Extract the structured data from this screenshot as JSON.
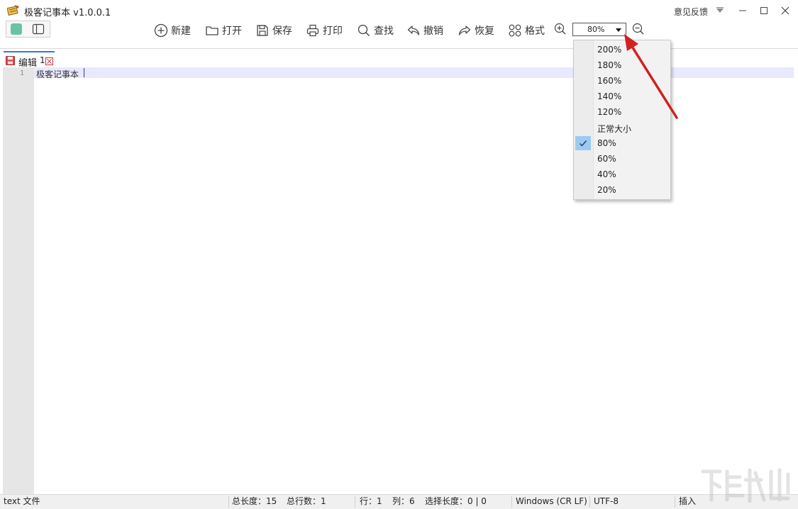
{
  "window": {
    "title": "极客记事本 v1.0.0.1",
    "feedback_label": "意见反馈"
  },
  "toolbar": {
    "new_label": "新建",
    "open_label": "打开",
    "save_label": "保存",
    "print_label": "打印",
    "find_label": "查找",
    "undo_label": "撤销",
    "redo_label": "恢复",
    "format_label": "格式",
    "zoom_value": "80%"
  },
  "tabs": [
    {
      "label": "编辑",
      "number": "1"
    }
  ],
  "editor": {
    "line_number": "1",
    "line_text": "极客记事本"
  },
  "zoom_menu": {
    "items": [
      "200%",
      "180%",
      "160%",
      "140%",
      "120%",
      "正常大小",
      "80%",
      "60%",
      "40%",
      "20%"
    ],
    "selected": "80%"
  },
  "status": {
    "file_type": "text 文件",
    "total_length": "总长度：15",
    "total_lines": "总行数：1",
    "row": "行：1",
    "col": "列：6",
    "selection": "选择长度：0 | 0",
    "line_ending": "Windows (CR LF)",
    "encoding": "UTF-8",
    "mode": "插入"
  },
  "colors": {
    "accent": "#2e7bd6",
    "arrow": "#d32020",
    "current_line": "#e8e8ff",
    "selected_menu": "#9ccbf2",
    "theme_green": "#6cc2a4"
  }
}
